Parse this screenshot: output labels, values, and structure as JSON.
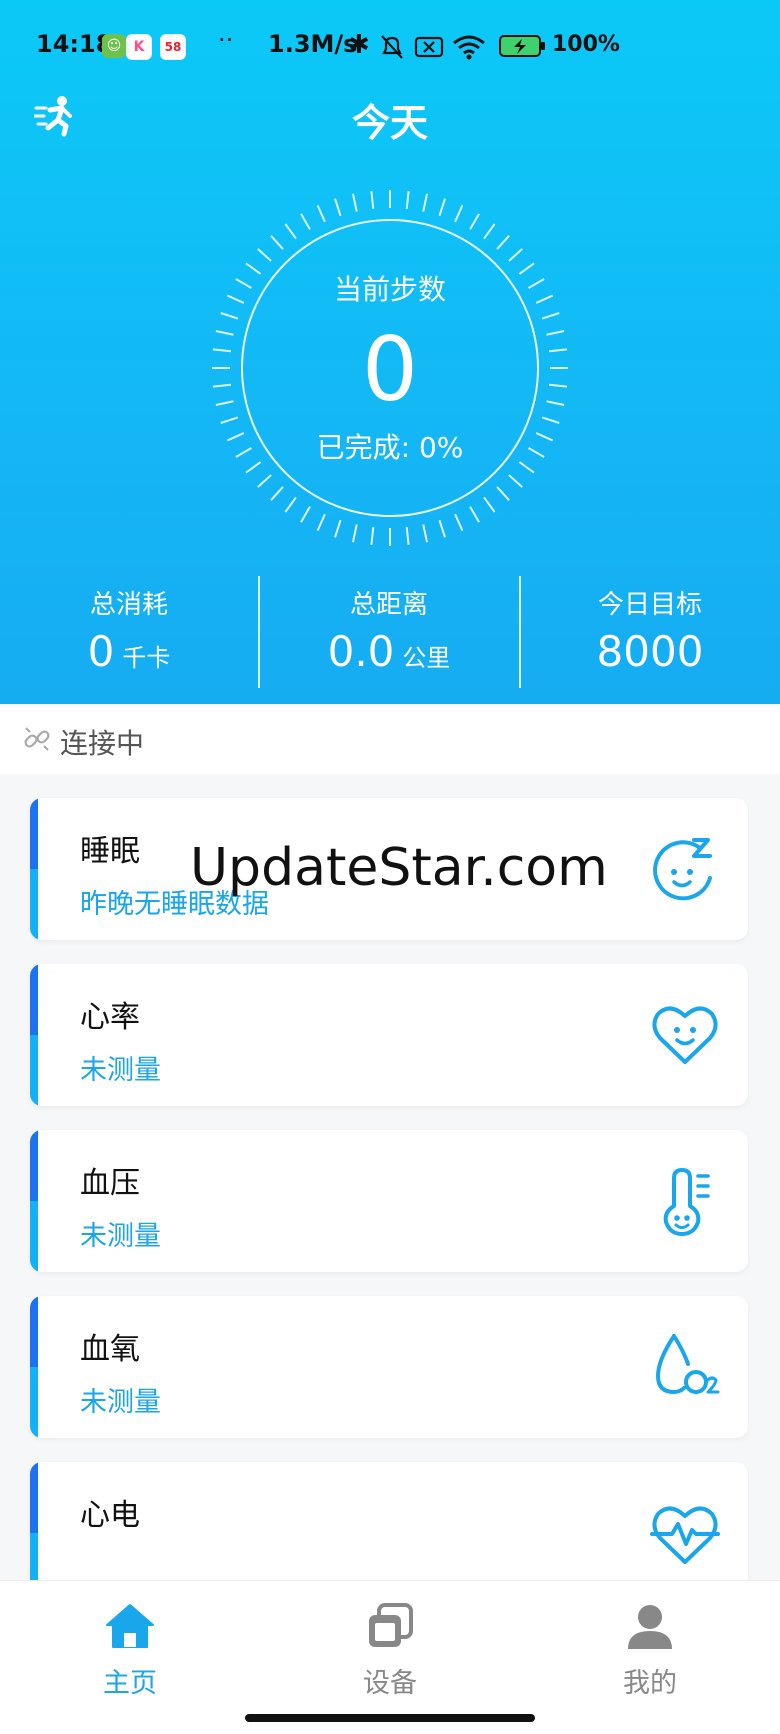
{
  "status_bar": {
    "time": "14:18",
    "app_badges": [
      {
        "icon": "cat-app-icon",
        "text": "",
        "color": "#6cc24a"
      },
      {
        "icon": "k-app-icon",
        "text": "K",
        "color": "#ff4f8a"
      },
      {
        "icon": "58-app-icon",
        "text": "58",
        "color": "#ffb300"
      }
    ],
    "overflow": "··",
    "net_speed": "1.3M/s",
    "battery": "100%"
  },
  "header": {
    "title": "今天"
  },
  "steps": {
    "label": "当前步数",
    "value": "0",
    "done_label": "已完成",
    "done_value": "0%"
  },
  "stats": [
    {
      "label": "总消耗",
      "value": "0",
      "unit": "千卡"
    },
    {
      "label": "总距离",
      "value": "0.0",
      "unit": "公里"
    },
    {
      "label": "今日目标",
      "value": "8000",
      "unit": ""
    }
  ],
  "connection": {
    "status": "连接中"
  },
  "cards": [
    {
      "title": "睡眠",
      "subtitle": "昨晚无睡眠数据",
      "icon": "sleep-face-icon"
    },
    {
      "title": "心率",
      "subtitle": "未测量",
      "icon": "heart-face-icon"
    },
    {
      "title": "血压",
      "subtitle": "未测量",
      "icon": "thermometer-face-icon"
    },
    {
      "title": "血氧",
      "subtitle": "未测量",
      "icon": "o2-drop-icon"
    },
    {
      "title": "心电",
      "subtitle": "",
      "icon": "ecg-heart-icon"
    }
  ],
  "watermark": "UpdateStar.com",
  "nav": [
    {
      "label": "主页",
      "icon": "home-icon",
      "active": true
    },
    {
      "label": "设备",
      "icon": "device-icon",
      "active": false
    },
    {
      "label": "我的",
      "icon": "profile-icon",
      "active": false
    }
  ],
  "colors": {
    "accent": "#14b7f5",
    "nav_active": "#1aa6ea",
    "nav_inactive": "#888888"
  }
}
